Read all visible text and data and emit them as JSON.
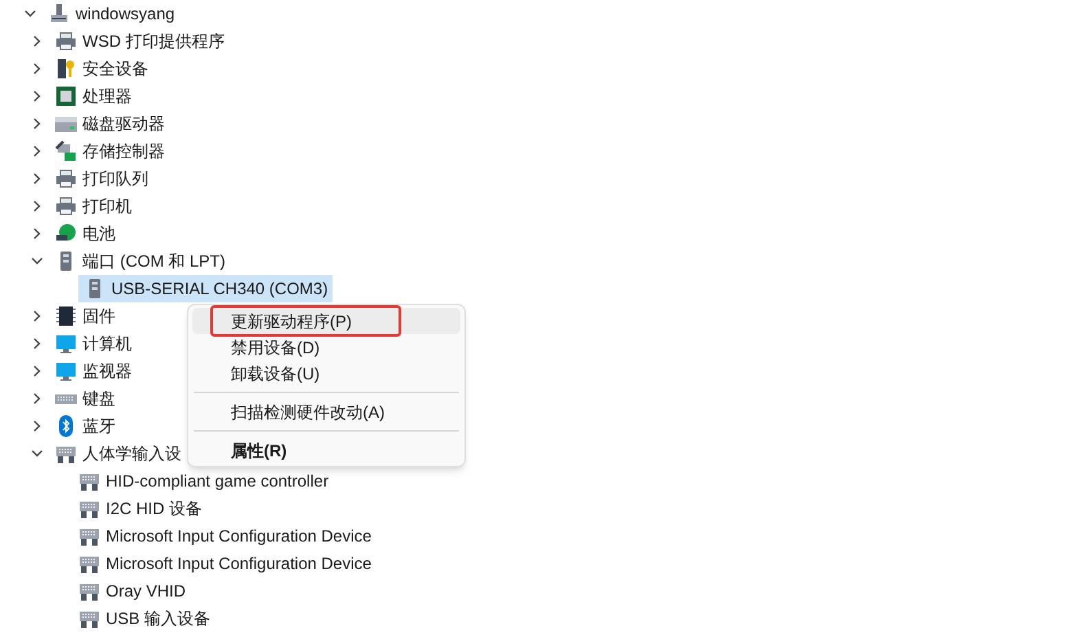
{
  "tree": {
    "label": "windowsyang",
    "kind": "computer",
    "expanded": true,
    "selected": false,
    "children": [
      {
        "label": "WSD 打印提供程序",
        "kind": "printer",
        "expanded": false,
        "selected": false
      },
      {
        "label": "安全设备",
        "kind": "security",
        "expanded": false,
        "selected": false
      },
      {
        "label": "处理器",
        "kind": "chip",
        "expanded": false,
        "selected": false
      },
      {
        "label": "磁盘驱动器",
        "kind": "disk",
        "expanded": false,
        "selected": false
      },
      {
        "label": "存储控制器",
        "kind": "storage",
        "expanded": false,
        "selected": false
      },
      {
        "label": "打印队列",
        "kind": "printer",
        "expanded": false,
        "selected": false
      },
      {
        "label": "打印机",
        "kind": "printer",
        "expanded": false,
        "selected": false
      },
      {
        "label": "电池",
        "kind": "battery",
        "expanded": false,
        "selected": false
      },
      {
        "label": "端口 (COM 和 LPT)",
        "kind": "port",
        "expanded": true,
        "selected": false,
        "children": [
          {
            "label": "USB-SERIAL CH340 (COM3)",
            "kind": "port",
            "selected": true
          }
        ]
      },
      {
        "label": "固件",
        "kind": "firmware",
        "expanded": false,
        "selected": false
      },
      {
        "label": "计算机",
        "kind": "monitor",
        "expanded": false,
        "selected": false
      },
      {
        "label": "监视器",
        "kind": "monitor",
        "expanded": false,
        "selected": false
      },
      {
        "label": "键盘",
        "kind": "keyboard",
        "expanded": false,
        "selected": false
      },
      {
        "label": "蓝牙",
        "kind": "bluetooth",
        "expanded": false,
        "selected": false
      },
      {
        "label": "人体学输入设",
        "kind": "hid",
        "expanded": true,
        "selected": false,
        "children": [
          {
            "label": "HID-compliant game controller",
            "kind": "hid",
            "selected": false
          },
          {
            "label": "I2C HID 设备",
            "kind": "hid",
            "selected": false
          },
          {
            "label": "Microsoft Input Configuration Device",
            "kind": "hid",
            "selected": false
          },
          {
            "label": "Microsoft Input Configuration Device",
            "kind": "hid",
            "selected": false
          },
          {
            "label": "Oray VHID",
            "kind": "hid",
            "selected": false
          },
          {
            "label": "USB 输入设备",
            "kind": "hid",
            "selected": false
          }
        ]
      }
    ]
  },
  "context_menu": {
    "items": [
      {
        "kind": "item",
        "label": "更新驱动程序(P)",
        "highlighted": true,
        "outlined": true,
        "bold": false
      },
      {
        "kind": "item",
        "label": "禁用设备(D)",
        "highlighted": false,
        "outlined": false,
        "bold": false
      },
      {
        "kind": "item",
        "label": "卸载设备(U)",
        "highlighted": false,
        "outlined": false,
        "bold": false
      },
      {
        "kind": "separator"
      },
      {
        "kind": "item",
        "label": "扫描检测硬件改动(A)",
        "highlighted": false,
        "outlined": false,
        "bold": false
      },
      {
        "kind": "separator"
      },
      {
        "kind": "item",
        "label": "属性(R)",
        "highlighted": false,
        "outlined": false,
        "bold": true
      }
    ]
  }
}
